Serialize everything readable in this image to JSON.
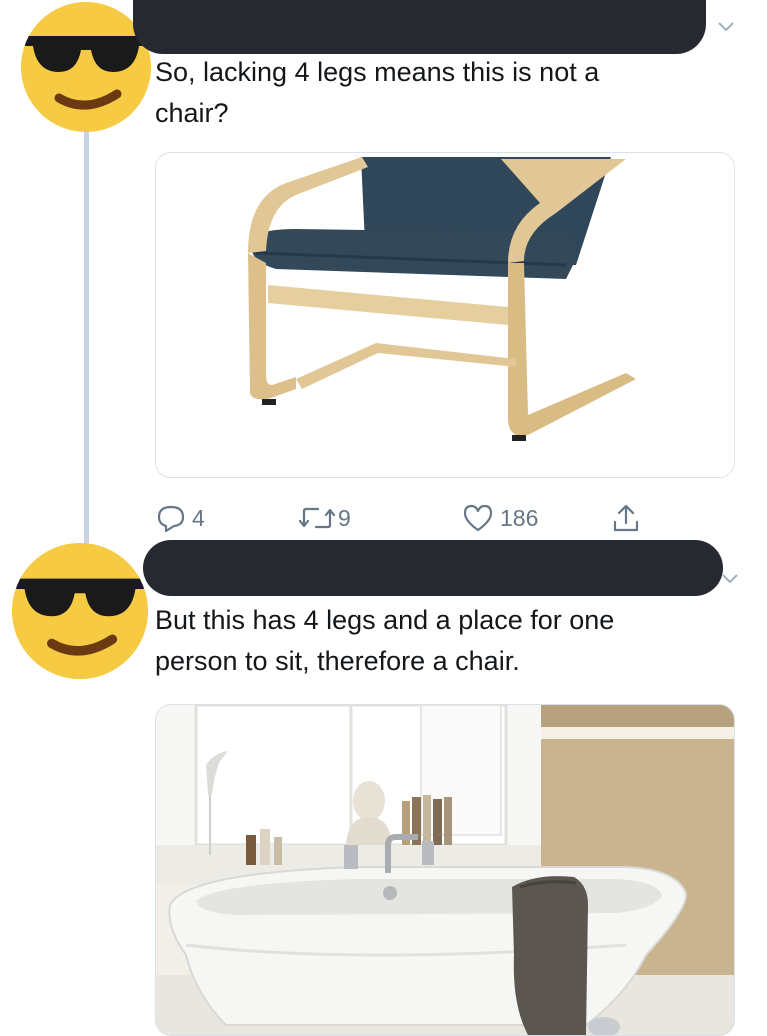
{
  "tweets": [
    {
      "avatar": "sunglasses-emoji-avatar",
      "author_redacted": true,
      "text": "So, lacking 4 legs means this is not a\nchair?",
      "media": "bentwood-armchair-photo",
      "actions": {
        "reply_count": "4",
        "retweet_count": "9",
        "like_count": "186"
      }
    },
    {
      "avatar": "sunglasses-emoji-avatar",
      "author_redacted": true,
      "text": "But this has 4 legs and a place for one\nperson to sit, therefore a chair.",
      "media": "clawfoot-bathtub-photo"
    }
  ],
  "icons": {
    "reply": "reply-icon",
    "retweet": "retweet-icon",
    "like": "heart-icon",
    "share": "share-icon",
    "more": "chevron-down-icon"
  },
  "colors": {
    "avatar_yellow": "#f6cb43",
    "redaction": "#262a30",
    "thread_line": "#c4d4e0",
    "action_gray": "#657786",
    "chair_fabric": "#2f4759",
    "chair_wood": "#e2c796"
  }
}
